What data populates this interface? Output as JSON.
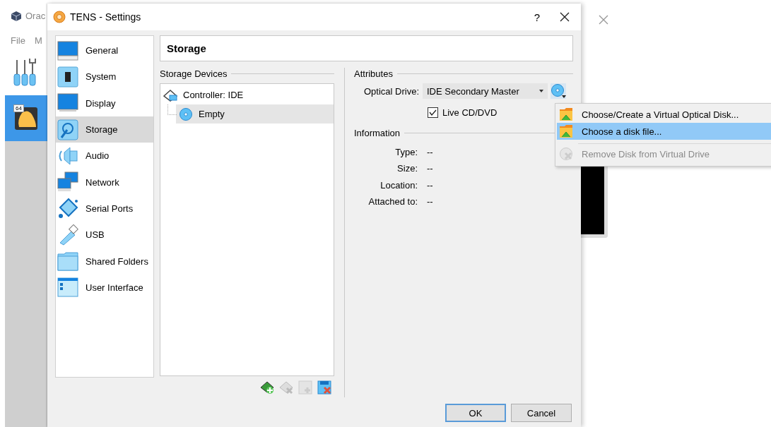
{
  "background_window": {
    "title": "Orac",
    "menu": [
      "File",
      "M"
    ],
    "vm_badge": "64"
  },
  "dialog": {
    "title": "TENS - Settings",
    "help": "?"
  },
  "sidebar": [
    {
      "label": "General",
      "kind": "general",
      "selected": false
    },
    {
      "label": "System",
      "kind": "system",
      "selected": false
    },
    {
      "label": "Display",
      "kind": "display",
      "selected": false
    },
    {
      "label": "Storage",
      "kind": "storage",
      "selected": true
    },
    {
      "label": "Audio",
      "kind": "audio",
      "selected": false
    },
    {
      "label": "Network",
      "kind": "network",
      "selected": false
    },
    {
      "label": "Serial Ports",
      "kind": "serial",
      "selected": false
    },
    {
      "label": "USB",
      "kind": "usb",
      "selected": false
    },
    {
      "label": "Shared Folders",
      "kind": "folder",
      "selected": false
    },
    {
      "label": "User Interface",
      "kind": "ui",
      "selected": false
    }
  ],
  "page_title": "Storage",
  "storage_devices": {
    "title": "Storage Devices",
    "tree": [
      {
        "label": "Controller: IDE",
        "kind": "controller",
        "selected": false,
        "children": [
          {
            "label": "Empty",
            "kind": "optical",
            "selected": true
          }
        ]
      }
    ]
  },
  "attributes": {
    "title": "Attributes",
    "optical_drive": {
      "label": "Optical Drive:",
      "value": "IDE Secondary Master"
    },
    "live_cd": {
      "label": "Live CD/DVD",
      "checked": true
    }
  },
  "information": {
    "title": "Information",
    "rows": [
      {
        "label": "Type:",
        "value": "--"
      },
      {
        "label": "Size:",
        "value": "--"
      },
      {
        "label": "Location:",
        "value": "--"
      },
      {
        "label": "Attached to:",
        "value": "--"
      }
    ]
  },
  "buttons": [
    {
      "label": "OK",
      "default": true
    },
    {
      "label": "Cancel",
      "default": false
    }
  ],
  "menu": [
    {
      "kind": "item",
      "label": "Choose/Create a Virtual Optical Disk...",
      "selected": false,
      "disabled": false
    },
    {
      "kind": "item",
      "label": "Choose a disk file...",
      "selected": true,
      "disabled": false
    },
    {
      "kind": "separator"
    },
    {
      "kind": "item",
      "label": "Remove Disk from Virtual Drive",
      "selected": false,
      "disabled": true
    }
  ]
}
